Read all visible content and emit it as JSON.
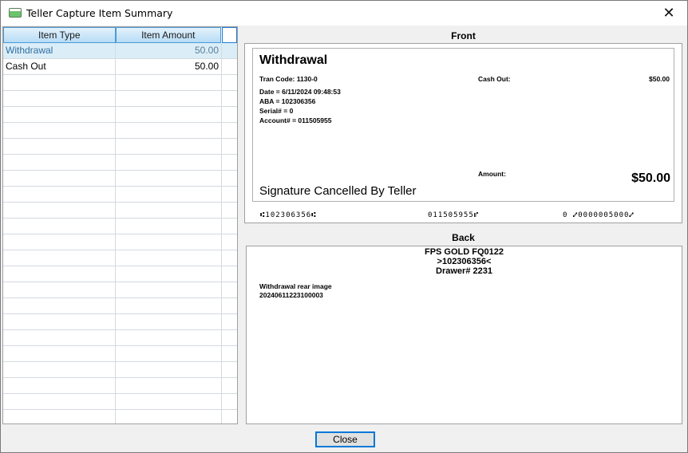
{
  "window": {
    "title": "Teller Capture Item Summary"
  },
  "grid": {
    "headers": {
      "type": "Item Type",
      "amount": "Item Amount"
    },
    "rows": [
      {
        "type": "Withdrawal",
        "amount": "50.00",
        "selected": true
      },
      {
        "type": "Cash Out",
        "amount": "50.00",
        "selected": false
      }
    ],
    "empty_rows": 22
  },
  "front": {
    "label": "Front",
    "heading": "Withdrawal",
    "tran_code": "Tran Code: 1130-0",
    "cash_out_label": "Cash Out:",
    "cash_out_value": "$50.00",
    "date": "Date = 6/11/2024 09:48:53",
    "aba": "ABA = 102306356",
    "serial": "Serial# = 0",
    "account": "Account# = 011505955",
    "amount_label": "Amount:",
    "amount_value": "$50.00",
    "signature": "Signature Cancelled By Teller",
    "micr_routing": "⑆102306356⑆",
    "micr_account": "011505955⑈",
    "micr_amount": "0  ⑇0000005000⑇"
  },
  "back": {
    "label": "Back",
    "line1": "FPS GOLD FQ0122",
    "line2": ">102306356<",
    "line3": "Drawer# 2231",
    "note1": "Withdrawal rear image",
    "note2": "20240611223100003"
  },
  "buttons": {
    "close": "Close"
  },
  "icons": {
    "app": "window-app-icon",
    "close": "close-icon"
  }
}
